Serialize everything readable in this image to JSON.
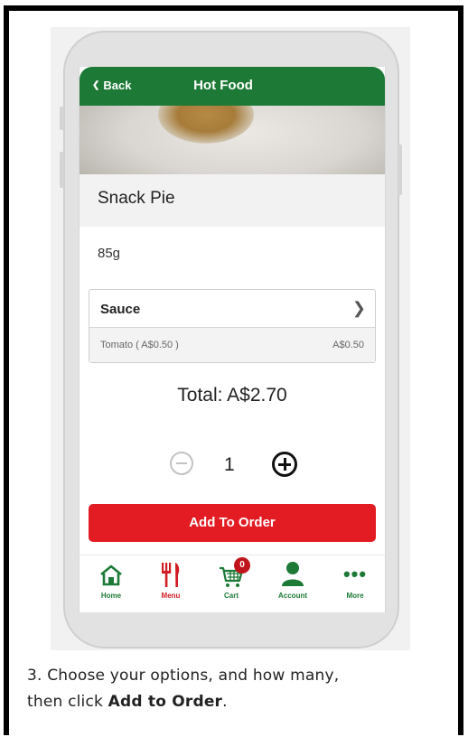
{
  "header": {
    "back_label": "Back",
    "title": "Hot Food"
  },
  "product": {
    "name": "Snack Pie",
    "weight": "85g"
  },
  "option_group": {
    "label": "Sauce",
    "selected": {
      "name": "Tomato ( A$0.50 )",
      "price": "A$0.50"
    }
  },
  "total": "Total: A$2.70",
  "quantity": "1",
  "add_button": "Add To Order",
  "tabs": [
    {
      "label": "Home",
      "icon": "home-icon"
    },
    {
      "label": "Menu",
      "icon": "cutlery-icon"
    },
    {
      "label": "Cart",
      "icon": "cart-icon",
      "badge": "0"
    },
    {
      "label": "Account",
      "icon": "user-icon"
    },
    {
      "label": "More",
      "icon": "more-dots-icon"
    }
  ],
  "caption": {
    "line1": "3. Choose your options, and how many,",
    "line2_prefix": "then click ",
    "line2_bold": "Add to Order",
    "line2_suffix": "."
  },
  "colors": {
    "brand_green": "#1d7a36",
    "accent_red": "#e31b23"
  }
}
